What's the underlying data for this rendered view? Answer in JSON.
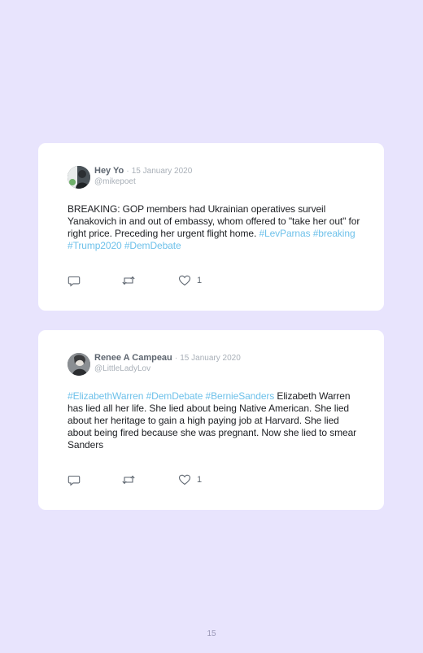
{
  "tweets": [
    {
      "author": "Hey Yo",
      "separator": "·",
      "date": "15 January 2020",
      "handle": "@mikepoet",
      "body": [
        {
          "text": "BREAKING: GOP members had Ukrainian operatives surveil Yanakovich in and out of embassy, whom offered to \"take her out\" for right price. Preceding her urgent flight home. ",
          "hashtag": false
        },
        {
          "text": "#LevParnas",
          "hashtag": true
        },
        {
          "text": " ",
          "hashtag": false
        },
        {
          "text": "#breaking",
          "hashtag": true
        },
        {
          "text": " ",
          "hashtag": false
        },
        {
          "text": "#Trump2020",
          "hashtag": true
        },
        {
          "text": " ",
          "hashtag": false
        },
        {
          "text": "#DemDebate",
          "hashtag": true
        }
      ],
      "likes": "1"
    },
    {
      "author": "Renee A Campeau",
      "separator": "·",
      "date": "15 January 2020",
      "handle": "@LittleLadyLov",
      "body": [
        {
          "text": "#ElizabethWarren",
          "hashtag": true
        },
        {
          "text": " ",
          "hashtag": false
        },
        {
          "text": "#DemDebate",
          "hashtag": true
        },
        {
          "text": " ",
          "hashtag": false
        },
        {
          "text": "#BernieSanders",
          "hashtag": true
        },
        {
          "text": " Elizabeth Warren has lied all her life. She lied about being Native American. She lied about her heritage to gain a high paying job at Harvard. She lied about being fired because she was pregnant. Now she lied to smear Sanders",
          "hashtag": false
        }
      ],
      "likes": "1"
    }
  ],
  "page_number": "15",
  "colors": {
    "background": "#e8e4fd",
    "card": "#ffffff",
    "hashtag": "#6ec1ea",
    "icon": "#5e6670"
  },
  "icons": {
    "reply": "reply-icon",
    "retweet": "retweet-icon",
    "like": "heart-icon"
  }
}
